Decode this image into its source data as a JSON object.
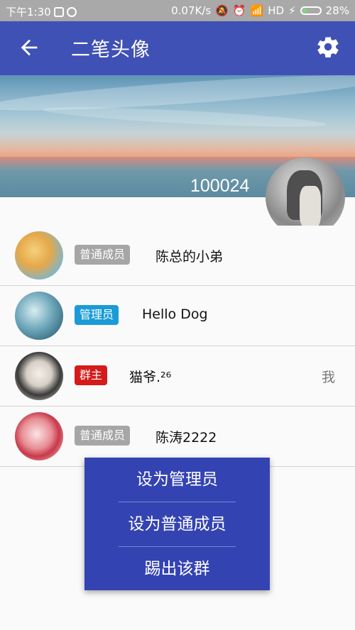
{
  "status_bar": {
    "time": "下午1:30",
    "speed": "0.07K/s",
    "network": "HD",
    "battery": "28%"
  },
  "app_bar": {
    "title": "二笔头像",
    "back_icon": "arrow-left-icon",
    "settings_icon": "gear-icon"
  },
  "group": {
    "id": "100024"
  },
  "members": [
    {
      "role": "普通成员",
      "name": "陈总的小弟",
      "me": ""
    },
    {
      "role": "管理员",
      "name": "Hello Dog",
      "me": ""
    },
    {
      "role": "群主",
      "name": "猫爷.²⁶",
      "me": "我"
    },
    {
      "role": "普通成员",
      "name": "陈涛2222",
      "me": ""
    }
  ],
  "popup_menu": {
    "items": [
      "设为管理员",
      "设为普通成员",
      "踢出该群"
    ]
  },
  "colors": {
    "primary": "#3f51b5",
    "popup": "#3443b2",
    "badge_member": "#a6a6a6",
    "badge_admin": "#1a9bd7",
    "badge_owner": "#d51a1a"
  }
}
